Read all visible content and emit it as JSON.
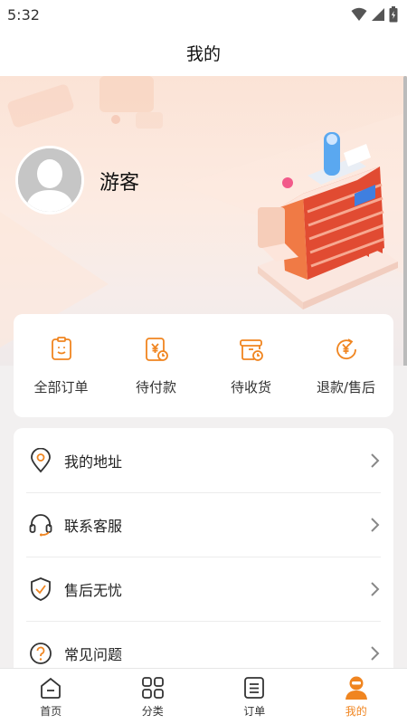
{
  "status": {
    "time": "5:32"
  },
  "header": {
    "title": "我的"
  },
  "profile": {
    "username": "游客",
    "avatar_icon": "person-silhouette-icon"
  },
  "orders": [
    {
      "label": "全部订单",
      "icon": "clipboard-icon"
    },
    {
      "label": "待付款",
      "icon": "yen-bill-icon"
    },
    {
      "label": "待收货",
      "icon": "package-icon"
    },
    {
      "label": "退款/售后",
      "icon": "refund-yen-icon"
    }
  ],
  "menu": [
    {
      "label": "我的地址",
      "icon": "location-pin-icon"
    },
    {
      "label": "联系客服",
      "icon": "headset-icon"
    },
    {
      "label": "售后无忧",
      "icon": "shield-check-icon"
    },
    {
      "label": "常见问题",
      "icon": "question-icon"
    }
  ],
  "tabs": [
    {
      "label": "首页",
      "icon": "home-icon",
      "active": false
    },
    {
      "label": "分类",
      "icon": "grid-icon",
      "active": false
    },
    {
      "label": "订单",
      "icon": "list-icon",
      "active": false
    },
    {
      "label": "我的",
      "icon": "person-icon",
      "active": true
    }
  ],
  "colors": {
    "accent": "#f08520",
    "icon_dark": "#333333",
    "background": "#f2f0f0"
  }
}
